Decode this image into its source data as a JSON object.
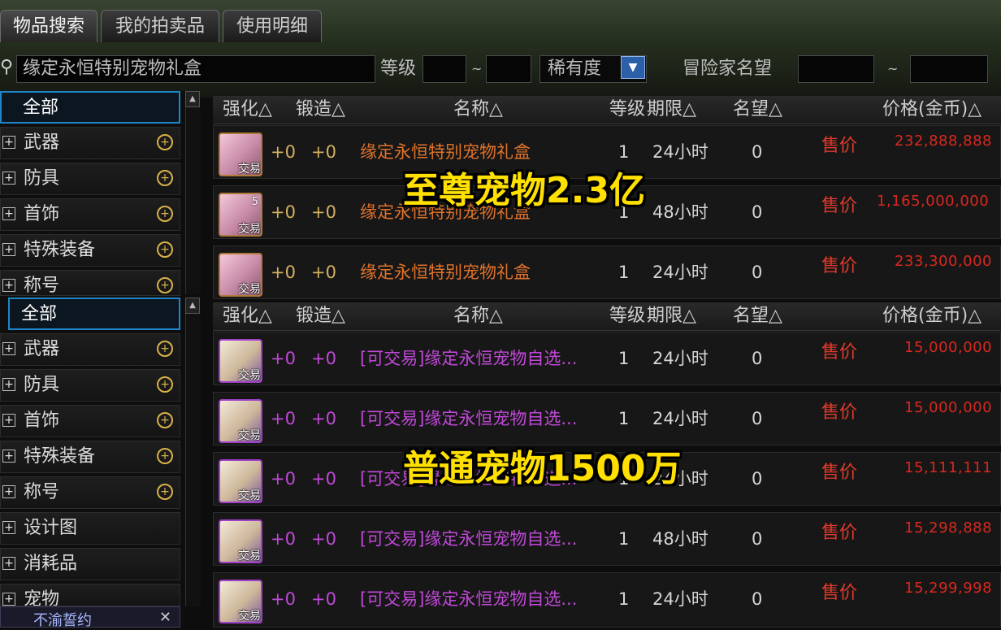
{
  "tabs": [
    "物品搜索",
    "我的拍卖品",
    "使用明细"
  ],
  "search": {
    "value": "缘定永恒特别宠物礼盒",
    "level_label": "等级",
    "level_sep": "~",
    "rarity_label": "稀有度",
    "fame_label": "冒险家名望",
    "fame_sep": "~"
  },
  "sidebar_upper": {
    "all": "全部",
    "items": [
      "武器",
      "防具",
      "首饰",
      "特殊装备",
      "称号"
    ]
  },
  "sidebar_lower": {
    "all": "全部",
    "items": [
      "武器",
      "防具",
      "首饰",
      "特殊装备",
      "称号",
      "设计图",
      "消耗品",
      "宠物"
    ]
  },
  "bottom_text": "不渝誓约",
  "headers": {
    "enhance": "强化△",
    "forge": "锻造△",
    "name": "名称△",
    "level": "等级",
    "period": "期限△",
    "fame": "名望△",
    "price": "价格(金币)△"
  },
  "icon_tag": "交易",
  "sell_label": "售价",
  "table1": [
    {
      "enhance": "+0",
      "forge": "+0",
      "name": "缘定永恒特别宠物礼盒",
      "level": "1",
      "period": "24小时",
      "fame": "0",
      "price": "232,888,888",
      "count": ""
    },
    {
      "enhance": "+0",
      "forge": "+0",
      "name": "缘定永恒特别宠物礼盒",
      "level": "1",
      "period": "48小时",
      "fame": "0",
      "price": "1,165,000,000",
      "count": "5"
    },
    {
      "enhance": "+0",
      "forge": "+0",
      "name": "缘定永恒特别宠物礼盒",
      "level": "1",
      "period": "24小时",
      "fame": "0",
      "price": "233,300,000",
      "count": ""
    }
  ],
  "table2": [
    {
      "enhance": "+0",
      "forge": "+0",
      "name": "[可交易]缘定永恒宠物自选...",
      "level": "1",
      "period": "24小时",
      "fame": "0",
      "price": "15,000,000"
    },
    {
      "enhance": "+0",
      "forge": "+0",
      "name": "[可交易]缘定永恒宠物自选...",
      "level": "1",
      "period": "24小时",
      "fame": "0",
      "price": "15,000,000"
    },
    {
      "enhance": "+0",
      "forge": "+0",
      "name": "[可交易]缘定永恒宠物自选...",
      "level": "1",
      "period": "24小时",
      "fame": "0",
      "price": "15,111,111"
    },
    {
      "enhance": "+0",
      "forge": "+0",
      "name": "[可交易]缘定永恒宠物自选...",
      "level": "1",
      "period": "48小时",
      "fame": "0",
      "price": "15,298,888"
    },
    {
      "enhance": "+0",
      "forge": "+0",
      "name": "[可交易]缘定永恒宠物自选...",
      "level": "1",
      "period": "24小时",
      "fame": "0",
      "price": "15,299,998"
    }
  ],
  "overlays": [
    "至尊宠物2.3亿",
    "普通宠物1500万"
  ]
}
